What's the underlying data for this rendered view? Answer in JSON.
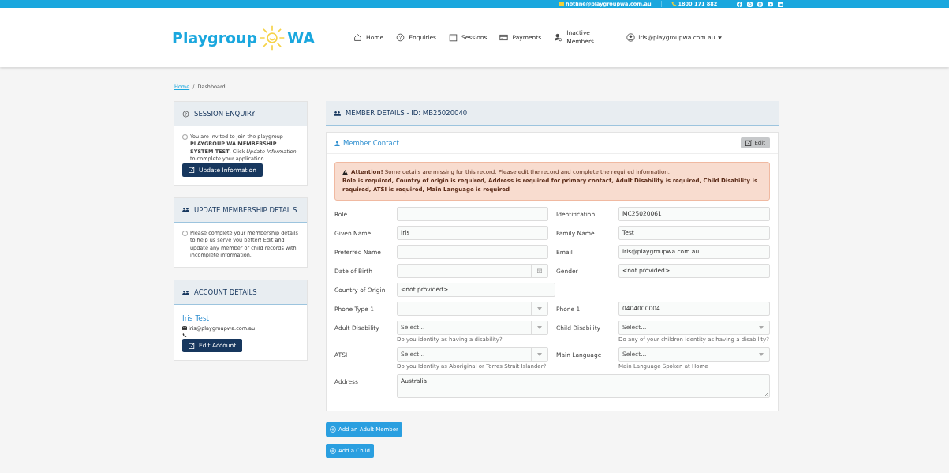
{
  "top_bar": {
    "email": "hotline@playgroupwa.com.au",
    "phone": "1800 171 882"
  },
  "header": {
    "logo_left": "Playgroup",
    "logo_right": "WA",
    "nav": [
      {
        "label": "Home"
      },
      {
        "label": "Enquiries"
      },
      {
        "label": "Sessions"
      },
      {
        "label": "Payments"
      },
      {
        "label": "Inactive Members"
      }
    ],
    "user": "iris@playgroupwa.com.au"
  },
  "breadcrumb": {
    "link": "Home",
    "separator": "/",
    "current": "Dashboard"
  },
  "sidebar": [
    {
      "title": "SESSION ENQUIRY",
      "kind": "enquiry",
      "text": "You are invited to join the playgroup **PLAYGROUP WA MEMBERSHIP SYSTEM TEST**. Click *Update Information* to complete your application.",
      "button": "Update Information"
    },
    {
      "title": "UPDATE MEMBERSHIP DETAILS",
      "kind": "info",
      "text": "Please complete your membership details to help us serve you better! Edit and update any member or child records with incomplete information."
    },
    {
      "title": "ACCOUNT DETAILS",
      "kind": "account",
      "name": "Iris Test",
      "email": "iris@playgroupwa.com.au",
      "button": "Edit Account"
    }
  ],
  "member": {
    "title": "MEMBER DETAILS - ID: MB25020040",
    "card_title": "Member Contact",
    "edit": "Edit",
    "alert": {
      "text": "**Attention!** Some details are missing for this record. Please edit the record and complete the required information.",
      "details": "Role is required, Country of origin is required, Address is required for primary contact, Adult Disability is required, Child Disability is required, ATSI is required, Main Language is required"
    },
    "rows": [
      [
        {
          "label": "Role",
          "kind": "text"
        },
        {
          "label": "Identification",
          "kind": "text",
          "value": "MC25020061"
        }
      ],
      [
        {
          "label": "Given Name",
          "kind": "text",
          "value": "Iris"
        },
        {
          "label": "Family Name",
          "kind": "text",
          "value": "Test"
        }
      ],
      [
        {
          "label": "Preferred Name",
          "kind": "text"
        },
        {
          "label": "Email",
          "kind": "text",
          "value": "iris@playgroupwa.com.au"
        }
      ],
      [
        {
          "label": "Date of Birth",
          "kind": "date"
        },
        {
          "label": "Gender",
          "kind": "text",
          "value": "<not provided>"
        }
      ],
      [
        {
          "label": "Country of Origin",
          "kind": "text",
          "value": "<not provided>"
        }
      ],
      [
        {
          "label": "Phone Type 1",
          "kind": "select"
        },
        {
          "label": "Phone 1",
          "kind": "text",
          "value": "0404000004"
        }
      ],
      [
        {
          "label": "Adult Disability",
          "kind": "select",
          "placeholder": "Select...",
          "hint": "Do you identity as having a disability?"
        },
        {
          "label": "Child Disability",
          "kind": "select",
          "placeholder": "Select...",
          "hint": "Do any of your children identity as having a disability?"
        }
      ],
      [
        {
          "label": "ATSI",
          "kind": "select",
          "placeholder": "Select...",
          "hint": "Do you Identity as Aboriginal or Torres Strait Islander?"
        },
        {
          "label": "Main Language",
          "kind": "select",
          "placeholder": "Select...",
          "hint": "Main Language Spoken at Home"
        }
      ],
      [
        {
          "label": "Address",
          "kind": "textarea",
          "value": "Australia"
        }
      ]
    ],
    "buttons": [
      "Add an Adult Member",
      "Add a Child"
    ]
  }
}
